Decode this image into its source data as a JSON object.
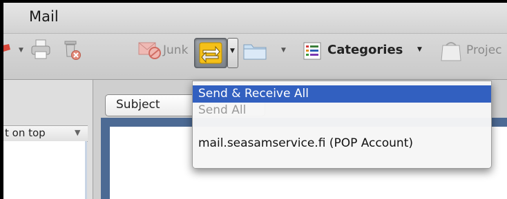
{
  "window": {
    "title": "Mail"
  },
  "toolbar": {
    "junk_label": "Junk",
    "categories_label": "Categories",
    "projects_label": "Projec",
    "icons": [
      "flag-icon",
      "print-icon",
      "delete-icon",
      "junk-icon",
      "send-receive-icon",
      "folder-icon",
      "categories-icon",
      "projects-icon"
    ]
  },
  "sort": {
    "label": "t on top",
    "arrow": "▼"
  },
  "subject_field": {
    "label": "Subject"
  },
  "send_receive_menu": {
    "items": [
      {
        "label": "Send & Receive All",
        "state": "highlighted"
      },
      {
        "label": "Send All",
        "state": "disabled"
      },
      {
        "label": "mail.seasamservice.fi (POP Account)",
        "state": "enabled"
      }
    ]
  },
  "colors": {
    "highlight": "#3260c0",
    "preview_border": "#4c6a94"
  }
}
